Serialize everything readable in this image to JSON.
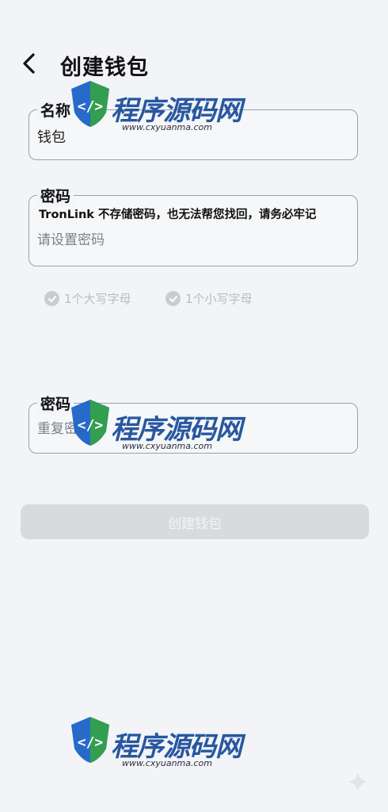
{
  "header": {
    "title": "创建钱包"
  },
  "name_field": {
    "label": "名称",
    "value": "钱包"
  },
  "password_field": {
    "label": "密码",
    "hint": "TronLink 不存储密码，也无法帮您找回，请务必牢记",
    "placeholder": "请设置密码"
  },
  "rules": [
    {
      "label": "1个大写字母"
    },
    {
      "label": "1个小写字母"
    }
  ],
  "confirm_field": {
    "label": "密码",
    "placeholder": "重复密码"
  },
  "create_button": {
    "label": "创建钱包"
  },
  "watermark": {
    "brand": "程序源码网",
    "url": "www.cxyuanma.com"
  },
  "colors": {
    "background": "#f2f4f7",
    "border": "#9aa0a8",
    "button_disabled": "#d8dadd",
    "watermark_blue": "#1d4f9c"
  }
}
